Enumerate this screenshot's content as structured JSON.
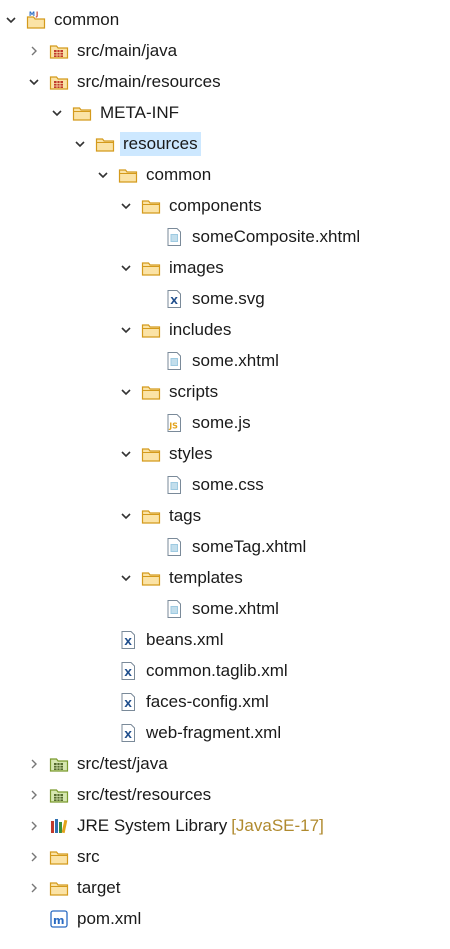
{
  "tree": {
    "rows": [
      {
        "label": "common",
        "depth": 0,
        "state": "expanded",
        "icon": "maven-project"
      },
      {
        "label": "src/main/java",
        "depth": 1,
        "state": "collapsed",
        "icon": "source-folder"
      },
      {
        "label": "src/main/resources",
        "depth": 1,
        "state": "expanded",
        "icon": "source-folder"
      },
      {
        "label": "META-INF",
        "depth": 2,
        "state": "expanded",
        "icon": "folder"
      },
      {
        "label": "resources",
        "depth": 3,
        "state": "expanded",
        "icon": "folder",
        "selected": true
      },
      {
        "label": "common",
        "depth": 4,
        "state": "expanded",
        "icon": "folder"
      },
      {
        "label": "components",
        "depth": 5,
        "state": "expanded",
        "icon": "folder"
      },
      {
        "label": "someComposite.xhtml",
        "depth": 6,
        "state": "leaf",
        "icon": "html-file"
      },
      {
        "label": "images",
        "depth": 5,
        "state": "expanded",
        "icon": "folder"
      },
      {
        "label": "some.svg",
        "depth": 6,
        "state": "leaf",
        "icon": "xml-file"
      },
      {
        "label": "includes",
        "depth": 5,
        "state": "expanded",
        "icon": "folder"
      },
      {
        "label": "some.xhtml",
        "depth": 6,
        "state": "leaf",
        "icon": "html-file"
      },
      {
        "label": "scripts",
        "depth": 5,
        "state": "expanded",
        "icon": "folder"
      },
      {
        "label": "some.js",
        "depth": 6,
        "state": "leaf",
        "icon": "js-file"
      },
      {
        "label": "styles",
        "depth": 5,
        "state": "expanded",
        "icon": "folder"
      },
      {
        "label": "some.css",
        "depth": 6,
        "state": "leaf",
        "icon": "html-file"
      },
      {
        "label": "tags",
        "depth": 5,
        "state": "expanded",
        "icon": "folder"
      },
      {
        "label": "someTag.xhtml",
        "depth": 6,
        "state": "leaf",
        "icon": "html-file"
      },
      {
        "label": "templates",
        "depth": 5,
        "state": "expanded",
        "icon": "folder"
      },
      {
        "label": "some.xhtml",
        "depth": 6,
        "state": "leaf",
        "icon": "html-file"
      },
      {
        "label": "beans.xml",
        "depth": 4,
        "state": "leaf",
        "icon": "xml-file"
      },
      {
        "label": "common.taglib.xml",
        "depth": 4,
        "state": "leaf",
        "icon": "xml-file"
      },
      {
        "label": "faces-config.xml",
        "depth": 4,
        "state": "leaf",
        "icon": "xml-file"
      },
      {
        "label": "web-fragment.xml",
        "depth": 4,
        "state": "leaf",
        "icon": "xml-file"
      },
      {
        "label": "src/test/java",
        "depth": 1,
        "state": "collapsed",
        "icon": "test-source-folder"
      },
      {
        "label": "src/test/resources",
        "depth": 1,
        "state": "collapsed",
        "icon": "test-source-folder"
      },
      {
        "label": "JRE System Library",
        "decoration": "[JavaSE-17]",
        "depth": 1,
        "state": "collapsed",
        "icon": "library"
      },
      {
        "label": "src",
        "depth": 1,
        "state": "collapsed",
        "icon": "folder"
      },
      {
        "label": "target",
        "depth": 1,
        "state": "collapsed",
        "icon": "folder"
      },
      {
        "label": "pom.xml",
        "depth": 1,
        "state": "leaf",
        "icon": "maven-pom"
      }
    ]
  },
  "colors": {
    "selection": "#cde8ff",
    "decoration": "#b08a2e",
    "folder": "#e8b23a",
    "chevron": "#333333"
  }
}
